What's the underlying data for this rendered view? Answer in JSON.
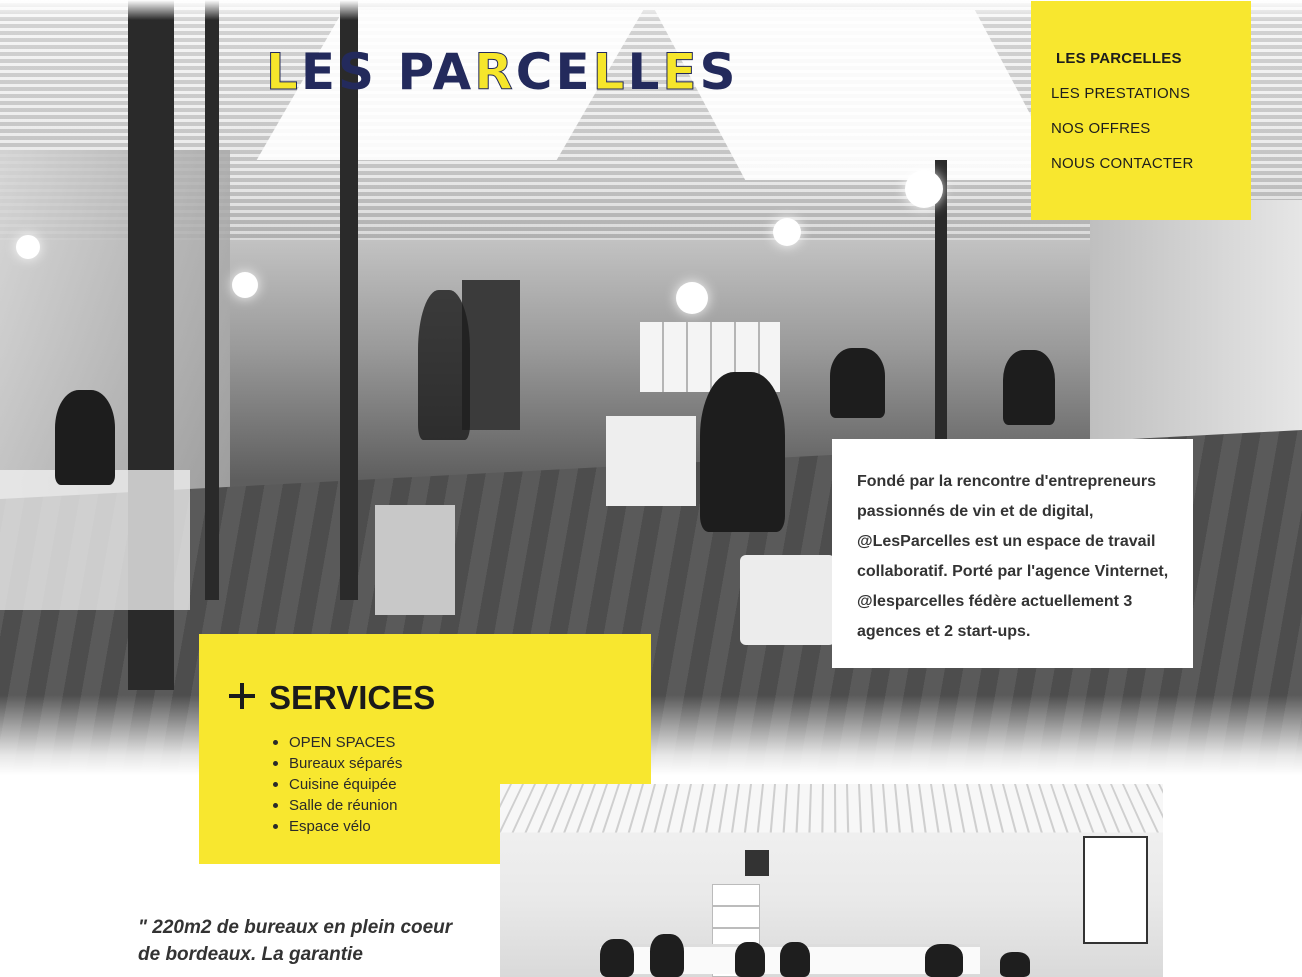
{
  "brand": {
    "logo_text": "LES PARCELLES",
    "primary_color": "#232a5c",
    "accent_color": "#f6e62b"
  },
  "nav": {
    "items": [
      {
        "label": "LES PARCELLES",
        "active": true
      },
      {
        "label": "LES PRESTATIONS",
        "active": false
      },
      {
        "label": "NOS OFFRES",
        "active": false
      },
      {
        "label": "NOUS CONTACTER",
        "active": false
      }
    ],
    "background": "#f8e72f"
  },
  "about": {
    "text": "Fondé par la rencontre d'entrepreneurs passionnés de vin et de digital, @LesParcelles est un espace de travail collaboratif. Porté par l'agence Vinternet, @lesparcelles fédère actuellement 3 agences et 2 start-ups."
  },
  "services": {
    "title": "SERVICES",
    "icon": "plus-icon",
    "items": [
      "OPEN SPACES",
      "Bureaux séparés",
      "Cuisine équipée",
      "Salle de réunion",
      "Espace vélo"
    ]
  },
  "quote": {
    "text": "\" 220m2 de bureaux en plein coeur de bordeaux. La garantie"
  },
  "images": {
    "hero": "coworking-open-space-photo",
    "room": "meeting-room-photo"
  }
}
